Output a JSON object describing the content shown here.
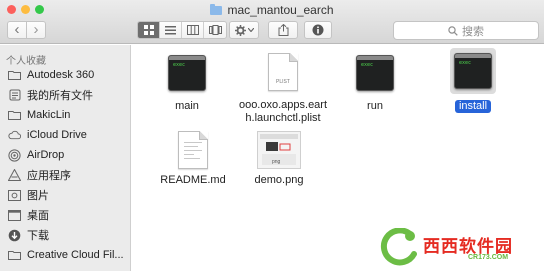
{
  "window": {
    "title": "mac_mantou_earch",
    "traffic_colors": [
      "#fc605c",
      "#fdbc40",
      "#34c84a"
    ]
  },
  "toolbar": {
    "back_glyph": "‹",
    "forward_glyph": "›",
    "view_modes": [
      "icon-view-icon",
      "list-view-icon",
      "column-view-icon",
      "cover-flow-icon"
    ],
    "search_placeholder": "搜索"
  },
  "sidebar": {
    "section_title": "个人收藏",
    "items": [
      {
        "label": "Autodesk 360",
        "icon": "folder-icon"
      },
      {
        "label": "我的所有文件",
        "icon": "all-files-icon"
      },
      {
        "label": "MakicLin",
        "icon": "home-folder-icon"
      },
      {
        "label": "iCloud Drive",
        "icon": "cloud-icon"
      },
      {
        "label": "AirDrop",
        "icon": "airdrop-icon"
      },
      {
        "label": "应用程序",
        "icon": "applications-icon"
      },
      {
        "label": "图片",
        "icon": "pictures-icon"
      },
      {
        "label": "桌面",
        "icon": "desktop-icon"
      },
      {
        "label": "下载",
        "icon": "downloads-icon"
      },
      {
        "label": "Creative Cloud Fil...",
        "icon": "creative-cloud-icon"
      }
    ]
  },
  "files": [
    {
      "name": "main",
      "kind": "exec",
      "badge": "exec"
    },
    {
      "name": "ooo.oxo.apps.earth.launchctl.plist",
      "name_line1": "ooo.oxo.apps.eart",
      "name_line2": "h.launchctl.plist",
      "kind": "plist",
      "badge": "PLIST"
    },
    {
      "name": "run",
      "kind": "exec",
      "badge": "exec"
    },
    {
      "name": "install",
      "kind": "exec",
      "badge": "exec",
      "selected": true
    },
    {
      "name": "README.md",
      "kind": "doc"
    },
    {
      "name": "demo.png",
      "kind": "png",
      "badge": "png"
    }
  ],
  "watermark": {
    "text": "西西软件园",
    "sub": "CR173.COM"
  }
}
